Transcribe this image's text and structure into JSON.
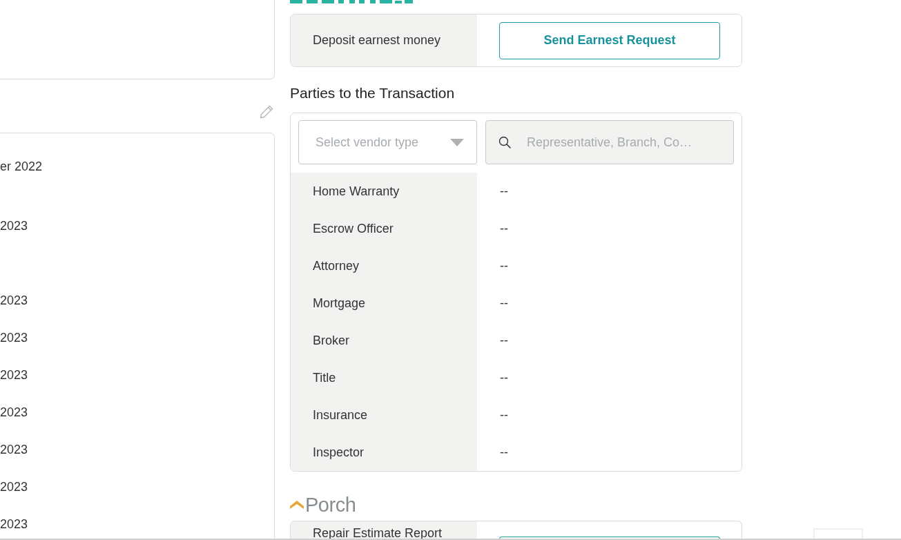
{
  "left_panel": {
    "date_rows": [
      "er 2022",
      "2023",
      "2023",
      "2023",
      "2023",
      "2023",
      "2023",
      "2023",
      "2023"
    ]
  },
  "earnest": {
    "row_label": "Deposit earnest money",
    "button": "Send Earnest Request"
  },
  "parties": {
    "title": "Parties to the Transaction",
    "vendor_select": {
      "placeholder": "Select vendor type"
    },
    "search": {
      "placeholder": "Representative, Branch, Co…"
    },
    "rows": [
      {
        "label": "Home Warranty",
        "value": "--"
      },
      {
        "label": "Escrow Officer",
        "value": "--"
      },
      {
        "label": "Attorney",
        "value": "--"
      },
      {
        "label": "Mortgage",
        "value": "--"
      },
      {
        "label": "Broker",
        "value": "--"
      },
      {
        "label": "Title",
        "value": "--"
      },
      {
        "label": "Insurance",
        "value": "--"
      },
      {
        "label": "Inspector",
        "value": "--"
      }
    ]
  },
  "porch": {
    "logo_text": "Porch",
    "row_label": "Repair Estimate Report"
  }
}
